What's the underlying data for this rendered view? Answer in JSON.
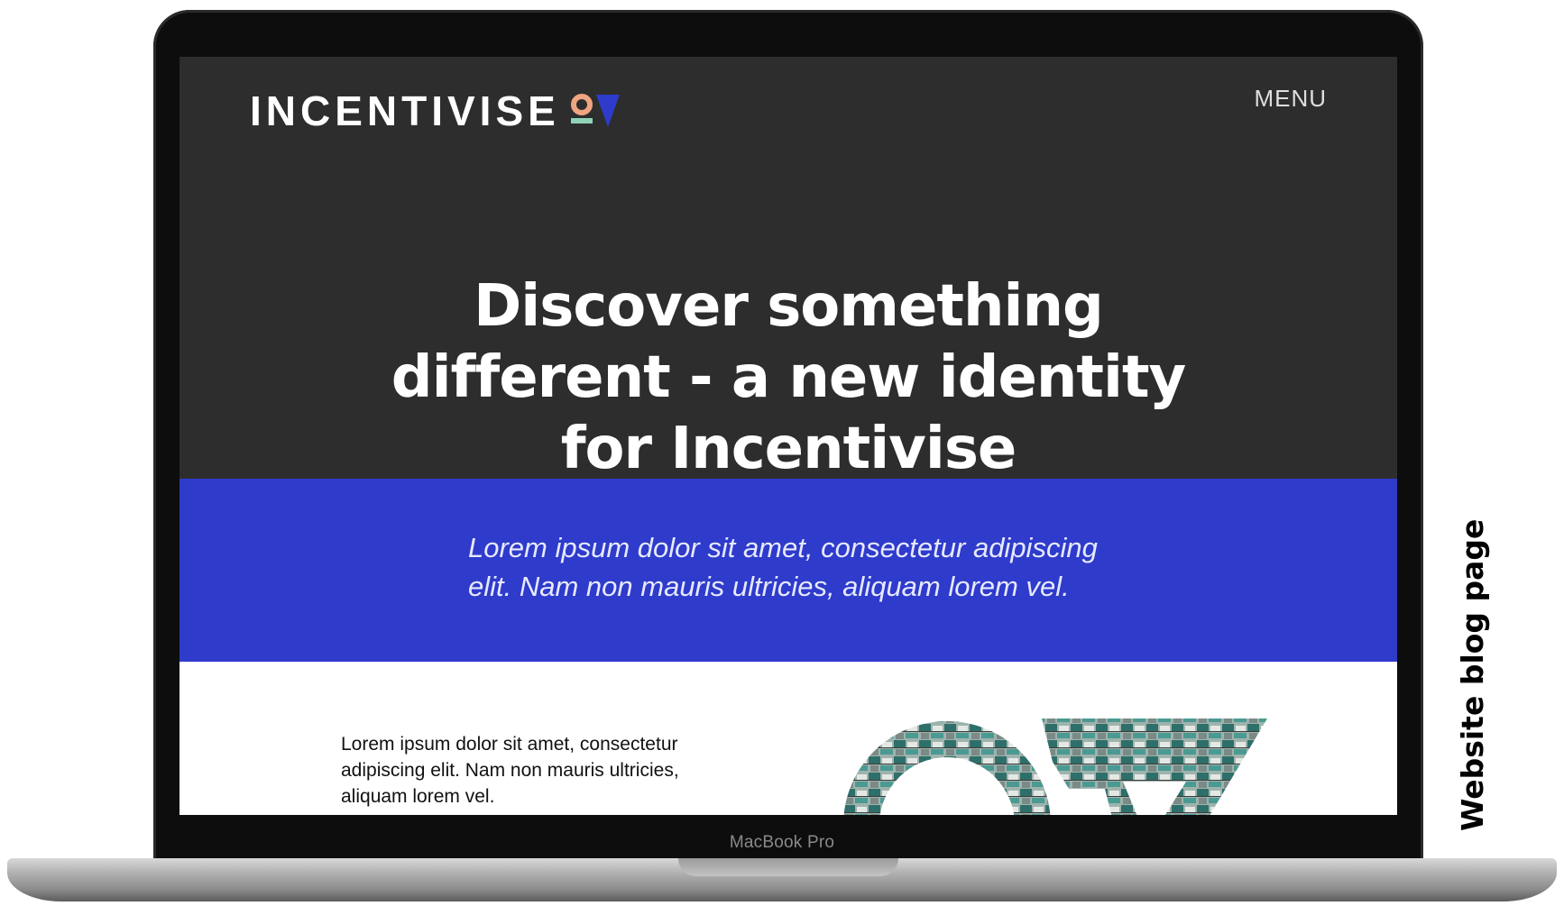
{
  "device": {
    "model_label": "MacBook Pro"
  },
  "site": {
    "logo": {
      "wordmark": "INCENTIVISE",
      "colors": {
        "circle": "#f0a481",
        "bar": "#8fd3b6",
        "triangle": "#2e3bcb"
      }
    },
    "menu_label": "MENU"
  },
  "hero": {
    "title": "Discover something different - a new identity for Incentivise"
  },
  "intro": {
    "text": "Lorem ipsum dolor sit amet, consectetur adipiscing elit. Nam non mauris ultricies, aliquam lorem vel."
  },
  "content": {
    "paragraph": "Lorem ipsum dolor sit amet, consectetur adipiscing elit. Nam non mauris ultricies, aliquam lorem vel.",
    "graphic": "building-photo-masked-logo-shapes"
  },
  "caption": "Website blog page",
  "colors": {
    "dark_bg": "#2d2d2d",
    "accent_blue": "#2e3bcb",
    "white": "#ffffff"
  }
}
